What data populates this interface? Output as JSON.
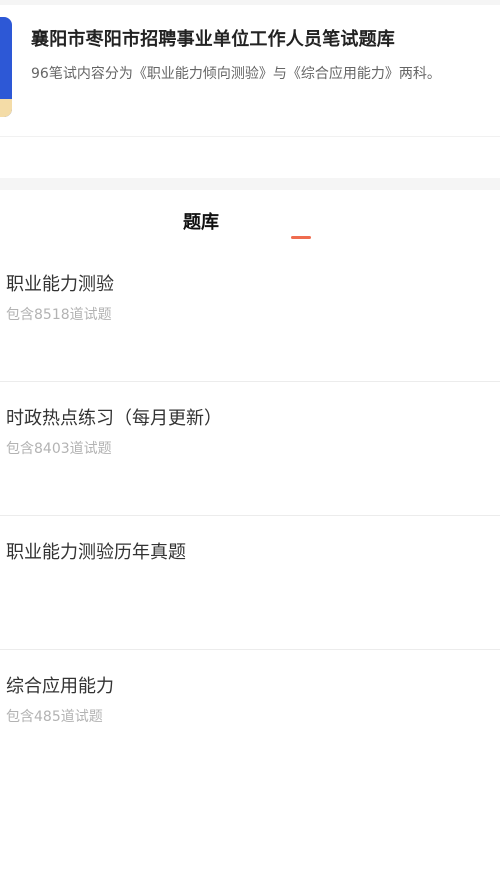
{
  "header": {
    "title": "襄阳市枣阳市招聘事业单位工作人员笔试题库",
    "description": "96笔试内容分为《职业能力倾向测验》与《综合应用能力》两科。"
  },
  "tabs": [
    {
      "label": "题库",
      "active": true
    }
  ],
  "colors": {
    "accent": "#ef6c4f",
    "cover_blue": "#2d58d6"
  },
  "items": [
    {
      "title": "职业能力测验",
      "subtitle": "包含8518道试题"
    },
    {
      "title": "时政热点练习（每月更新）",
      "subtitle": "包含8403道试题"
    },
    {
      "title": "职业能力测验历年真题",
      "subtitle": ""
    },
    {
      "title": "综合应用能力",
      "subtitle": "包含485道试题"
    }
  ]
}
